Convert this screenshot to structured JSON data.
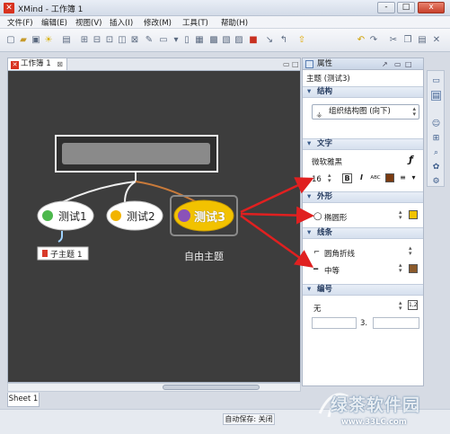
{
  "window": {
    "title": "XMind - 工作簿 1",
    "controls": [
      "-",
      "□",
      "x"
    ]
  },
  "menu": [
    "文件(F)",
    "编辑(E)",
    "视图(V)",
    "插入(I)",
    "修改(M)",
    "工具(T)",
    "帮助(H)"
  ],
  "editor": {
    "tab_label": "工作簿 1",
    "sheet_tab": "Sheet 1",
    "topics": {
      "subtopic_1": "测试1",
      "subtopic_2": "测试2",
      "subtopic_3": "测试3",
      "child": "子主题 1",
      "floating": "自由主题"
    }
  },
  "properties": {
    "panel_title": "属性",
    "subtitle": "主题 (测试3)",
    "structure": {
      "header": "结构",
      "value": "组织结构图 (向下)"
    },
    "text": {
      "header": "文字",
      "font": "微软雅黑",
      "size": "16",
      "bold": "B",
      "italic": "I",
      "abc": "ABC",
      "color": "#7a3a10"
    },
    "shape": {
      "header": "外形",
      "value": "椭圆形",
      "color": "#f2c200"
    },
    "line": {
      "header": "线条",
      "style": "圆角折线",
      "weight": "中等",
      "color": "#8b5a2b"
    },
    "numbering": {
      "header": "编号",
      "value": "无",
      "sep": "3."
    }
  },
  "status": {
    "autosave": "自动保存: 关闭"
  },
  "watermark": {
    "cn": "绿茶软件园",
    "url": "www.33LC.com"
  },
  "colors": {
    "canvas": "#3d3d3d",
    "arrow": "#e02020",
    "connector_selected": "#c87a3a"
  }
}
